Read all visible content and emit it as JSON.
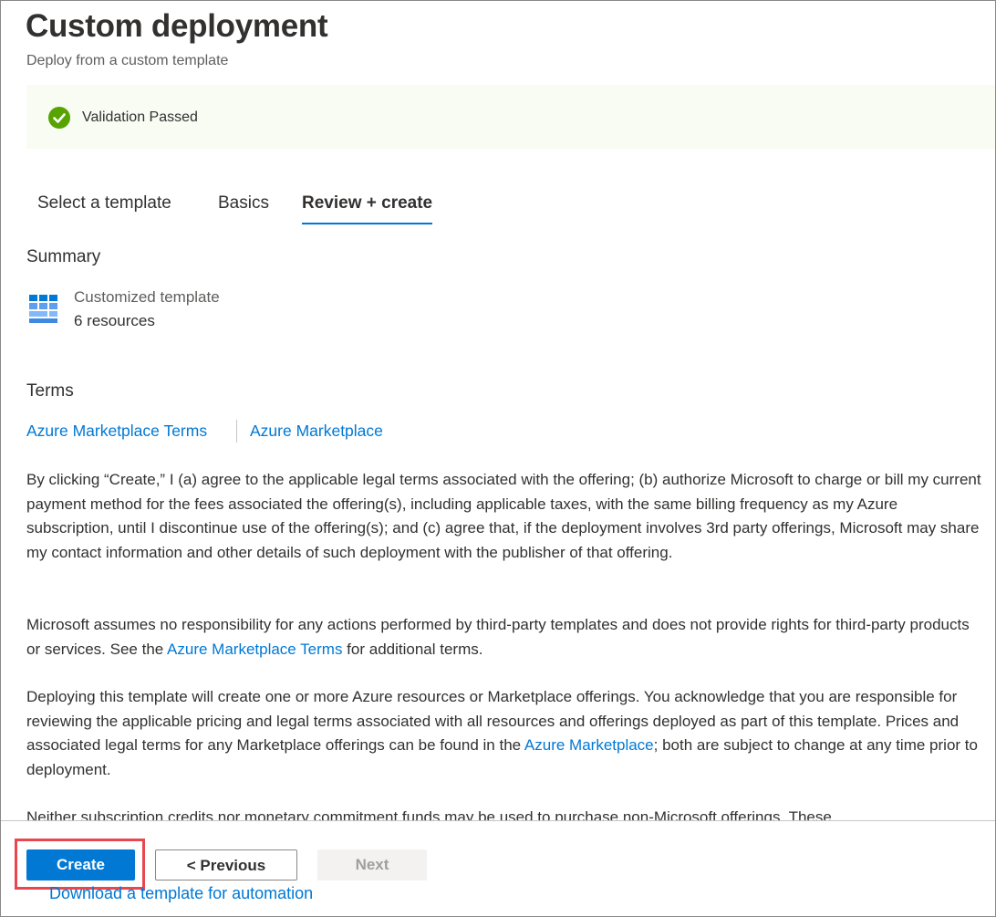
{
  "header": {
    "title": "Custom deployment",
    "subtitle": "Deploy from a custom template"
  },
  "banner": {
    "text": "Validation Passed",
    "icon": "check-circle-icon",
    "color": "#57a300"
  },
  "tabs": [
    {
      "label": "Select a template"
    },
    {
      "label": "Basics"
    },
    {
      "label": "Review + create",
      "active": true
    }
  ],
  "summary": {
    "heading": "Summary",
    "resource_title": "Customized template",
    "resource_count": "6 resources",
    "icon": "template-grid-icon"
  },
  "terms": {
    "heading": "Terms",
    "link1": "Azure Marketplace Terms",
    "link2": "Azure Marketplace",
    "para1": "By clicking “Create,” I (a) agree to the applicable legal terms associated with the offering; (b) authorize Microsoft to charge or bill my current payment method for the fees associated the offering(s), including applicable taxes, with the same billing frequency as my Azure subscription, until I discontinue use of the offering(s); and (c) agree that, if the deployment involves 3rd party offerings, Microsoft may share my contact information and other details of such deployment with the publisher of that offering.",
    "para2_before": "Microsoft assumes no responsibility for any actions performed by third-party templates and does not provide rights for third-party products or services. See the ",
    "para2_link": "Azure Marketplace Terms",
    "para2_after": " for additional terms.",
    "para3_before": "Deploying this template will create one or more Azure resources or Marketplace offerings.  You acknowledge that you are responsible for reviewing the applicable pricing and legal terms associated with all resources and offerings deployed as part of this template.  Prices and associated legal terms for any Marketplace offerings can be found in the ",
    "para3_link": "Azure Marketplace",
    "para3_after": "; both are subject to change at any time prior to deployment.",
    "para4": "Neither subscription credits nor monetary commitment funds may be used to purchase non-Microsoft offerings. These"
  },
  "footer": {
    "create": "Create",
    "previous": "< Previous",
    "next": "Next",
    "download": "Download a template for automation"
  },
  "colors": {
    "accent": "#0078d4",
    "highlight": "#e8474f",
    "banner_bg": "#f8fcf3"
  }
}
